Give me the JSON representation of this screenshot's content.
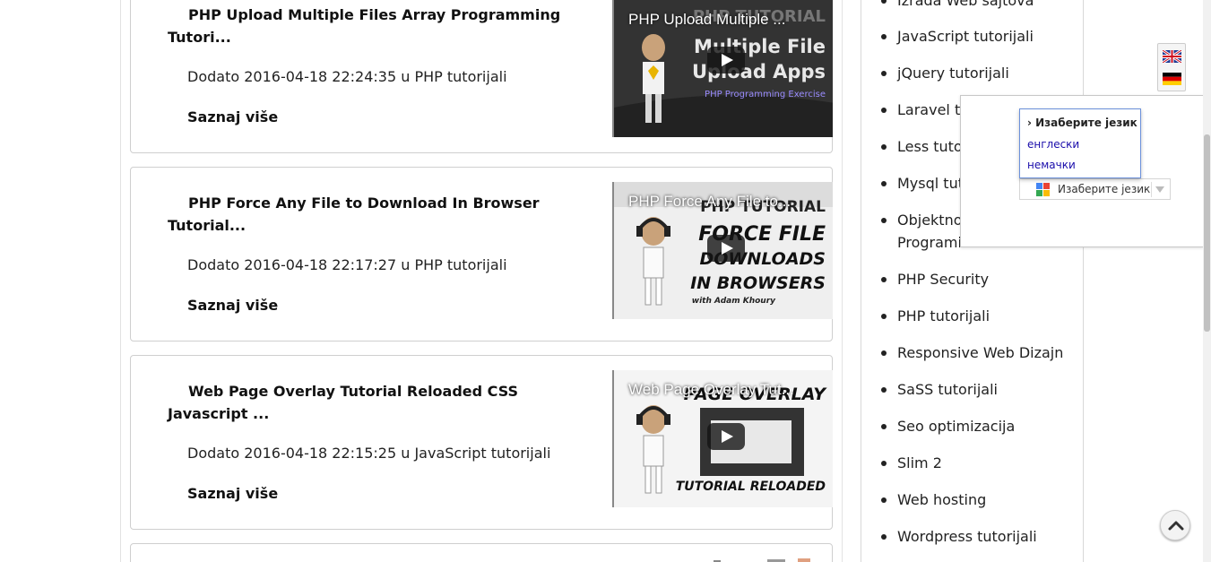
{
  "posts": [
    {
      "title": "PHP Upload Multiple Files Array Programming Tutori...",
      "meta": "Dodato 2016-04-18 22:24:35 u PHP tutorijali",
      "more": "Saznaj više",
      "video_title": "PHP Upload Multiple ...",
      "thumb_lines": [
        "PHP TUTORIAL",
        "Multiple File",
        "Upload Apps",
        "PHP Programming Exercise"
      ]
    },
    {
      "title": "PHP Force Any File to Download In Browser Tutorial...",
      "meta": "Dodato 2016-04-18 22:17:27 u PHP tutorijali",
      "more": "Saznaj više",
      "video_title": "PHP Force Any File to...",
      "thumb_lines": [
        "PHP TUTORIAL",
        "FORCE FILE",
        "DOWNLOADS",
        "IN BROWSERS",
        "with Adam Khoury"
      ]
    },
    {
      "title": "Web Page Overlay Tutorial Reloaded CSS Javascript ...",
      "meta": "Dodato 2016-04-18 22:15:25 u JavaScript tutorijali",
      "more": "Saznaj više",
      "video_title": "Web Page Overlay Tut...",
      "thumb_lines": [
        "PAGE OVERLAY",
        "TUTORIAL RELOADED"
      ]
    }
  ],
  "sidebar": {
    "categories": [
      "Izrada Web sajtova",
      "JavaScript tutorijali",
      "jQuery tutorijali",
      "Laravel tu",
      "Less tuto",
      "Mysql tut",
      "Objektno",
      "Programi",
      "PHP Security",
      "PHP tutorijali",
      "Responsive Web Dizajn",
      "SaSS tutorijali",
      "Seo optimizacija",
      "Slim 2",
      "Web hosting",
      "Wordpress tutorijali"
    ]
  },
  "translate": {
    "menu_header": "› Изаберите језик",
    "options": [
      "енглески",
      "немачки"
    ],
    "select_label": "Изаберите језик"
  },
  "flags": [
    "english-flag",
    "german-flag"
  ],
  "colors": {
    "link_blue": "#1a0dab",
    "menu_border": "#6b90da",
    "card_border": "#cfcfcf"
  }
}
